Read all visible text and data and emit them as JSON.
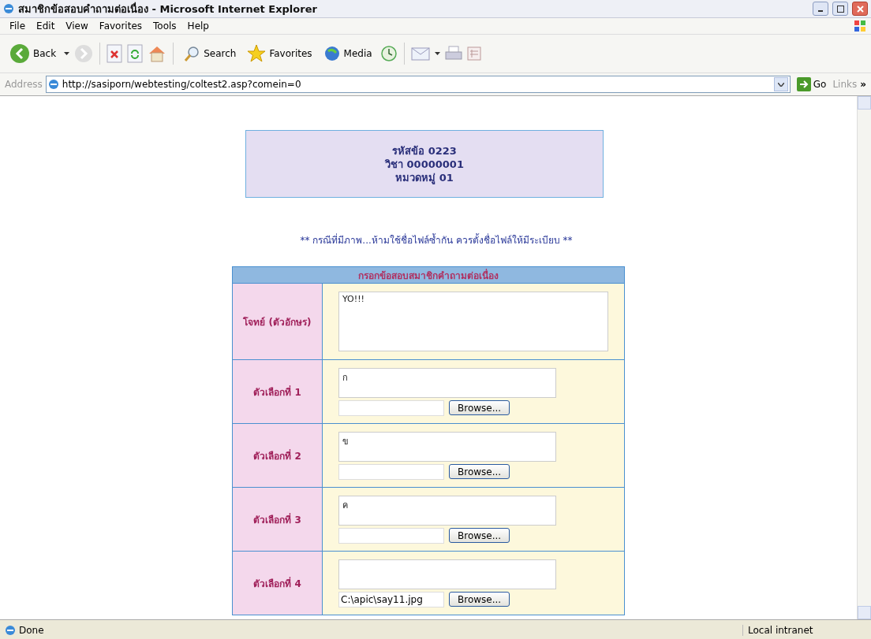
{
  "window": {
    "title": "สมาชิกข้อสอบคำถามต่อเนื่อง - Microsoft Internet Explorer"
  },
  "menu_bar": [
    "File",
    "Edit",
    "View",
    "Favorites",
    "Tools",
    "Help"
  ],
  "toolbar": {
    "back": "Back",
    "search": "Search",
    "favorites": "Favorites",
    "media": "Media"
  },
  "address_bar": {
    "label": "Address",
    "url": "http://sasiporn/webtesting/coltest2.asp?comein=0",
    "go": "Go",
    "links": "Links",
    "more": "»"
  },
  "page": {
    "header_lines": [
      "รหัสข้อ 0223",
      "วิชา 00000001",
      "หมวดหมู่ 01"
    ],
    "notice": "** กรณีที่มีภาพ...ห้ามใช้ชื่อไฟล์ซ้ำกัน ควรตั้งชื่อไฟล์ให้มีระเบียบ **",
    "form": {
      "title": "กรอกข้อสอบสมาชิกคำถามต่อเนื่อง",
      "rows": [
        {
          "kind": "question",
          "label": "โจทย์ (ตัวอักษร)",
          "text": "YO!!!"
        },
        {
          "kind": "choice",
          "label": "ตัวเลือกที่ 1",
          "text": "ก",
          "file": "",
          "browse": "Browse..."
        },
        {
          "kind": "choice",
          "label": "ตัวเลือกที่ 2",
          "text": "ข",
          "file": "",
          "browse": "Browse..."
        },
        {
          "kind": "choice",
          "label": "ตัวเลือกที่ 3",
          "text": "ค",
          "file": "",
          "browse": "Browse..."
        },
        {
          "kind": "choice",
          "label": "ตัวเลือกที่ 4",
          "text": "",
          "file": "C:\\apic\\say11.jpg",
          "browse": "Browse..."
        }
      ]
    }
  },
  "status_bar": {
    "text": "Done",
    "zone": "Local intranet"
  }
}
